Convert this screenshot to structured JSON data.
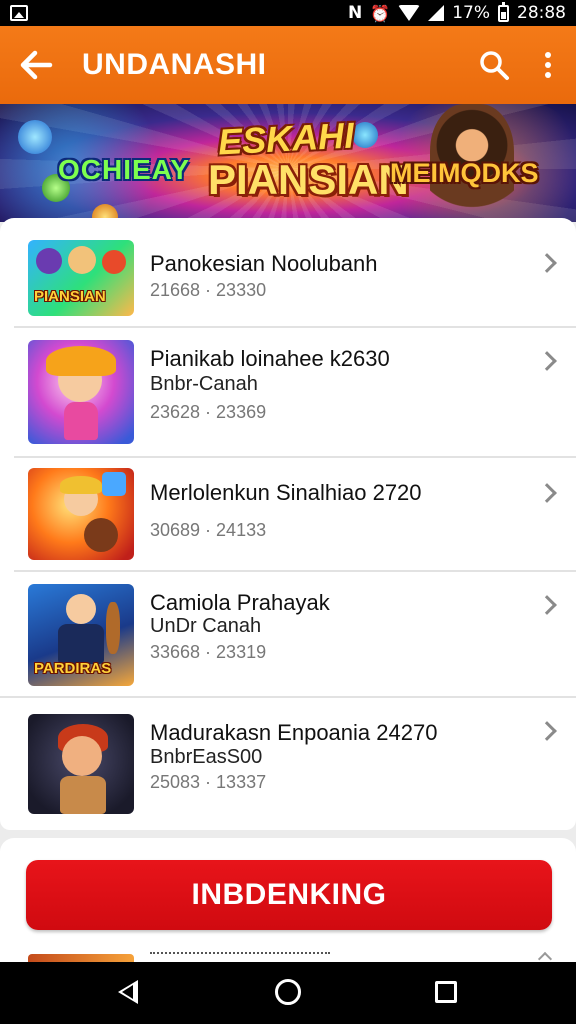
{
  "status_bar": {
    "time": "28:88",
    "battery_percent": "17%",
    "icons": [
      "gallery-icon",
      "nfc-icon",
      "alarm-icon",
      "wifi-icon",
      "signal-icon",
      "battery-icon"
    ],
    "nfc_glyph": "N",
    "alarm_glyph": "⏰"
  },
  "app_bar": {
    "title": "UNDANASHI",
    "back_icon": "arrow-left-icon",
    "search_icon": "search-icon",
    "more_icon": "more-vertical-icon",
    "color": "#f2741a"
  },
  "banner": {
    "left_text": "OCHIEAY",
    "center_line1": "ESKAHI",
    "center_line2": "PIANSIAN",
    "right_text": "MEIMQDKS"
  },
  "list": {
    "items": [
      {
        "title": "Panokesian Noolubanh",
        "subtitle": "",
        "meta": "21668 · 23330",
        "thumb_label": "PIANSIAN"
      },
      {
        "title": "Pianikab loinahee k2630",
        "subtitle": "Bnbr-Canah",
        "meta": "23628 · 23369",
        "thumb_label": ""
      },
      {
        "title": "Merlolenkun Sinalhiao 2720",
        "subtitle": "",
        "meta": "30689 · 24133",
        "thumb_label": ""
      },
      {
        "title": "Camiola Prahayak",
        "subtitle": "UnDr Canah",
        "meta": "33668 · 23319",
        "thumb_label": "PARDIRAS"
      },
      {
        "title": "Madurakasn Enpoania 24270",
        "subtitle": "BnbrEasS00",
        "meta": "25083 · 13337",
        "thumb_label": ""
      }
    ]
  },
  "cta": {
    "label": "INBDENKING",
    "color": "#e0101a"
  },
  "nav_bar": {
    "icons": [
      "back-triangle-icon",
      "home-circle-icon",
      "recents-square-icon"
    ]
  }
}
